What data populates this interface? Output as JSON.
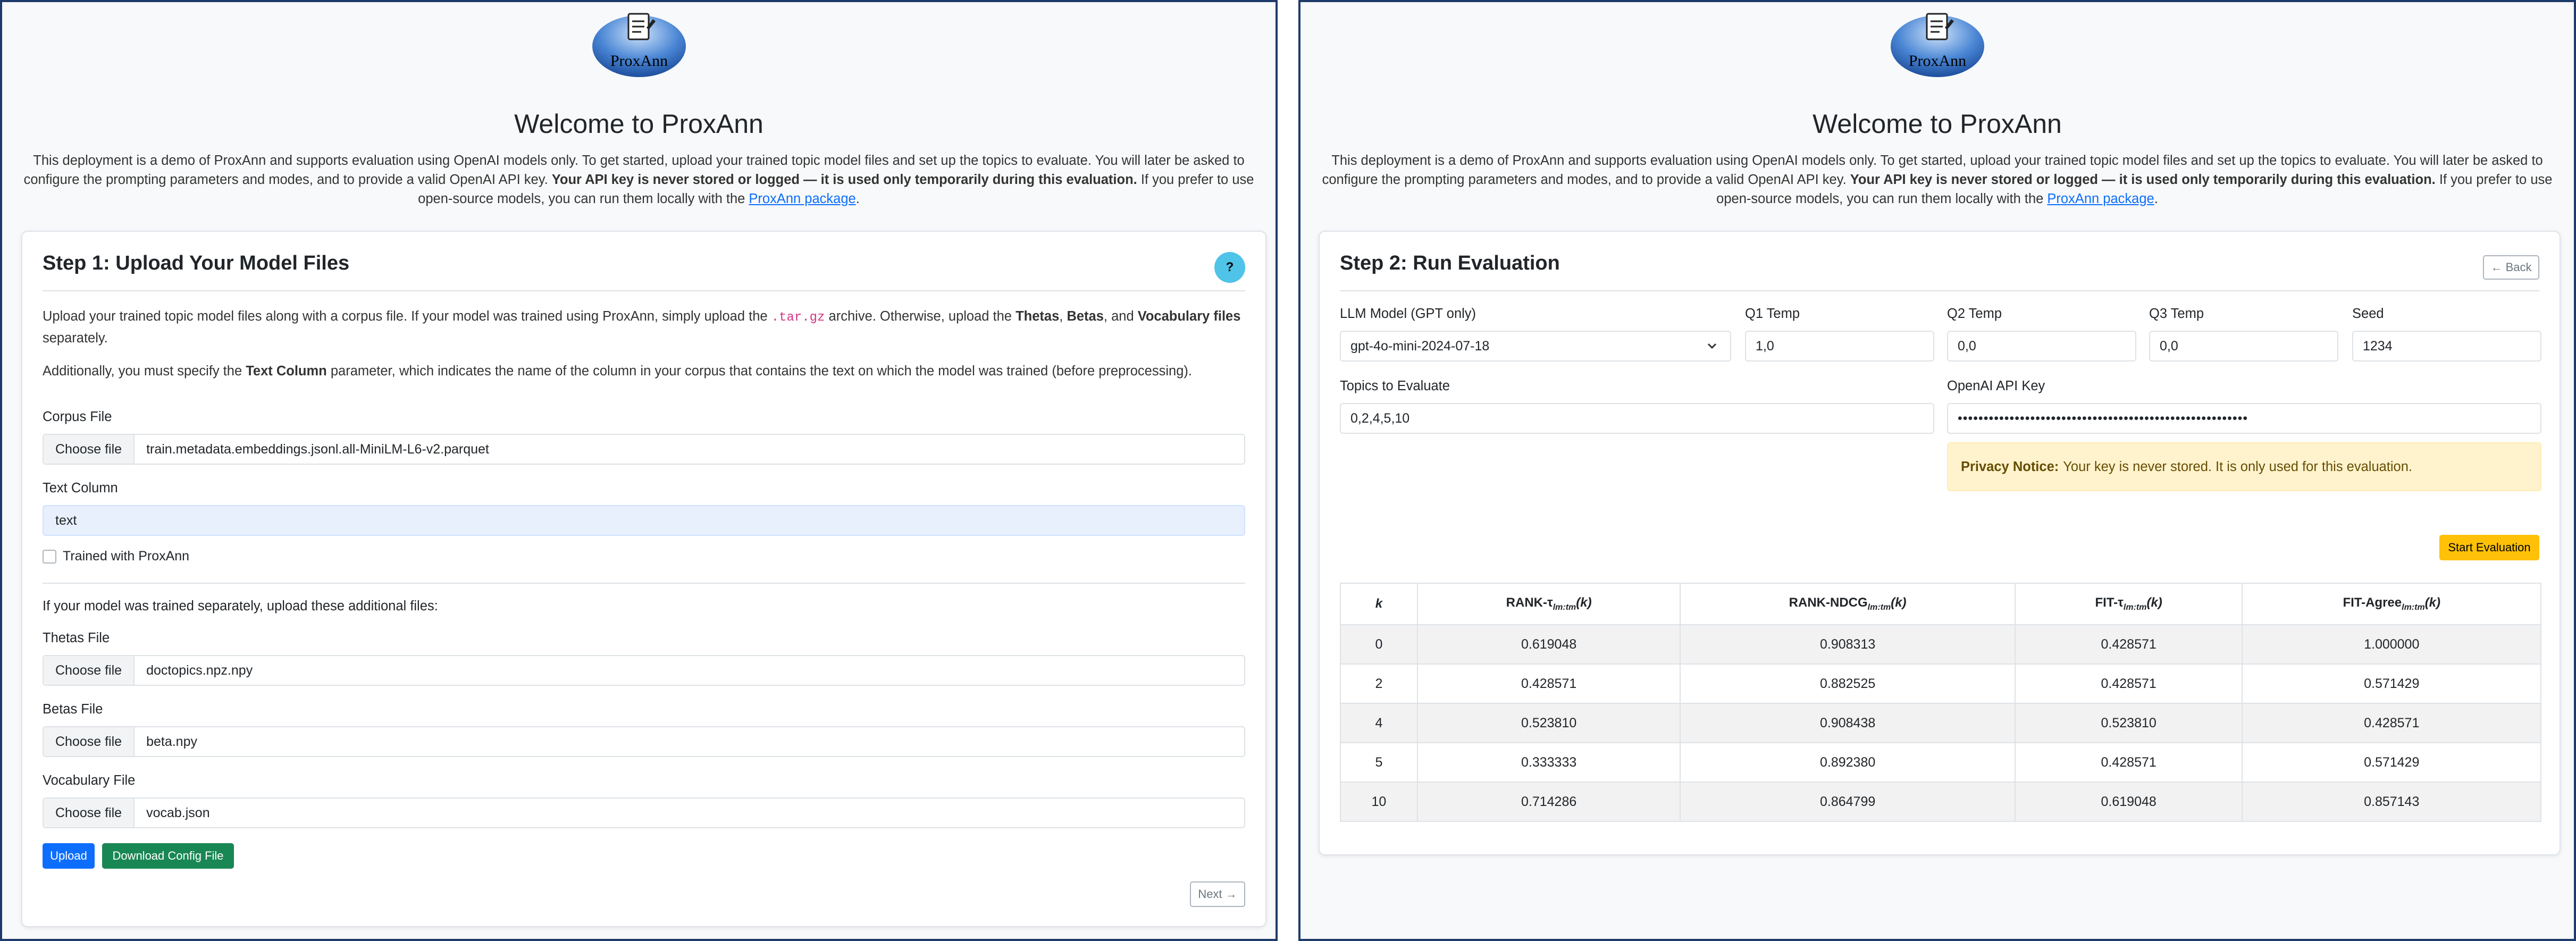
{
  "colors": {
    "primary": "#0d6efd",
    "success": "#198754",
    "warning": "#ffc107",
    "info": "#4fc3e8",
    "border": "#1f3b6b"
  },
  "logo_text": "ProxAnn",
  "left": {
    "welcome": "Welcome to ProxAnn",
    "intro": {
      "p1": "This deployment is a demo of ProxAnn and supports evaluation using OpenAI models only. To get started, upload your trained topic model files and set up the topics to evaluate. You will later be asked to configure the prompting parameters and modes, and to provide a valid OpenAI API key. ",
      "bold": "Your API key is never stored or logged — it is used only temporarily during this evaluation.",
      "p2": " If you prefer to use open-source models, you can run them locally with the ",
      "link": "ProxAnn package",
      "end": "."
    },
    "card_title": "Step 1: Upload Your Model Files",
    "help_label": "?",
    "para1": {
      "a": "Upload your trained topic model files along with a corpus file. If your model was trained using ProxAnn, simply upload the ",
      "code": ".tar.gz",
      "b": " archive. Otherwise, upload the ",
      "thetas": "Thetas",
      "c": ", ",
      "betas": "Betas",
      "d": ", and ",
      "vocab": "Vocabulary files",
      "e": " separately."
    },
    "para2": {
      "a": "Additionally, you must specify the ",
      "bold": "Text Column",
      "b": " parameter, which indicates the name of the column in your corpus that contains the text on which the model was trained (before preprocessing)."
    },
    "corpus_label": "Corpus File",
    "choose_label": "Choose file",
    "corpus_file": "train.metadata.embeddings.jsonl.all-MiniLM-L6-v2.parquet",
    "text_column_label": "Text Column",
    "text_column_value": "text",
    "trained_label": "Trained with ProxAnn",
    "separate_label": "If your model was trained separately, upload these additional files:",
    "thetas_label": "Thetas File",
    "thetas_file": "doctopics.npz.npy",
    "betas_label": "Betas File",
    "betas_file": "beta.npy",
    "vocab_label": "Vocabulary File",
    "vocab_file": "vocab.json",
    "upload_label": "Upload",
    "download_label": "Download Config File",
    "next_label": "Next →"
  },
  "right": {
    "welcome": "Welcome to ProxAnn",
    "card_title": "Step 2: Run Evaluation",
    "back_label": "← Back",
    "llm_label": "LLM Model (GPT only)",
    "llm_value": "gpt-4o-mini-2024-07-18",
    "q1_label": "Q1 Temp",
    "q1_value": "1,0",
    "q2_label": "Q2 Temp",
    "q2_value": "0,0",
    "q3_label": "Q3 Temp",
    "q3_value": "0,0",
    "seed_label": "Seed",
    "seed_value": "1234",
    "topics_label": "Topics to Evaluate",
    "topics_value": "0,2,4,5,10",
    "api_label": "OpenAI API Key",
    "api_value": "••••••••••••••••••••••••••••••••••••••••••••••••••••••••",
    "privacy_bold": "Privacy Notice:",
    "privacy_text": "Your key is never stored. It is only used for this evaluation.",
    "start_label": "Start Evaluation",
    "table": {
      "headers": [
        "k",
        "RANK-τ",
        "RANK-NDCG",
        "FIT-τ",
        "FIT-Agree"
      ],
      "sub": "lm:tm",
      "arg": "(k)",
      "rows": [
        [
          "0",
          "0.619048",
          "0.908313",
          "0.428571",
          "1.000000"
        ],
        [
          "2",
          "0.428571",
          "0.882525",
          "0.428571",
          "0.571429"
        ],
        [
          "4",
          "0.523810",
          "0.908438",
          "0.523810",
          "0.428571"
        ],
        [
          "5",
          "0.333333",
          "0.892380",
          "0.428571",
          "0.571429"
        ],
        [
          "10",
          "0.714286",
          "0.864799",
          "0.619048",
          "0.857143"
        ]
      ]
    }
  }
}
